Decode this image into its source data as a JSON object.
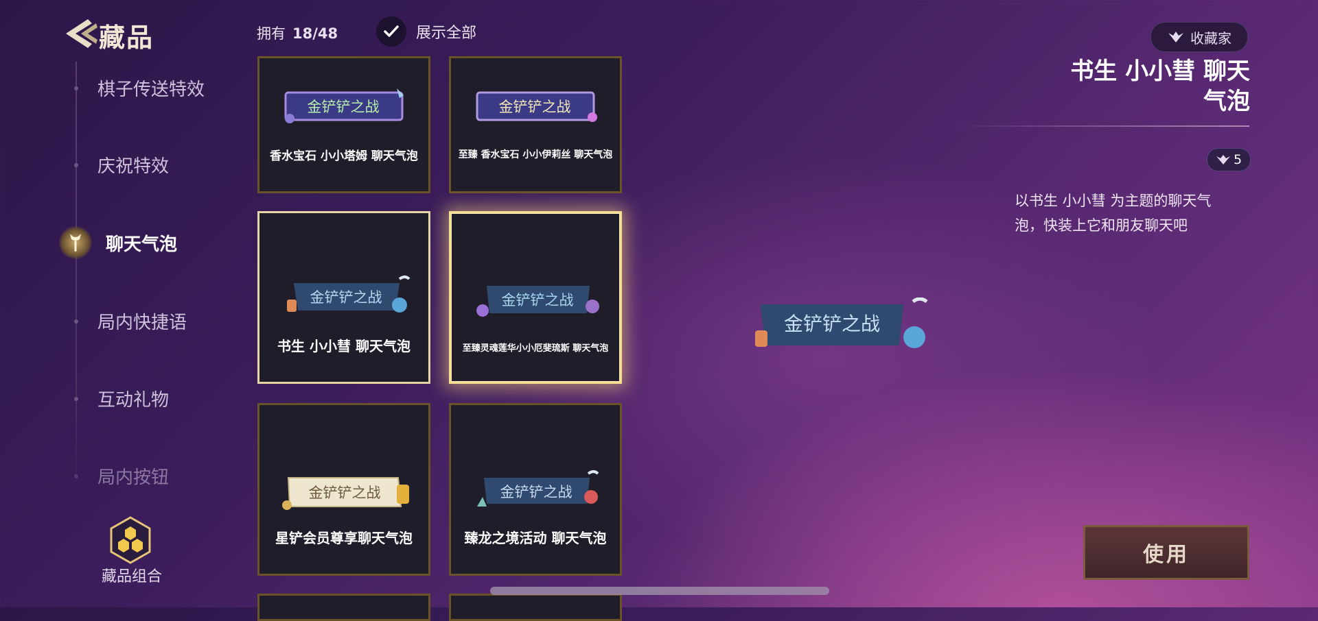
{
  "header": {
    "title": "藏品",
    "owned_label": "拥有",
    "owned_count": "18/48",
    "show_all_label": "展示全部"
  },
  "sidebar": {
    "items": [
      {
        "label": "棋子传送特效",
        "active": false
      },
      {
        "label": "庆祝特效",
        "active": false
      },
      {
        "label": "聊天气泡",
        "active": true
      },
      {
        "label": "局内快捷语",
        "active": false
      },
      {
        "label": "互动礼物",
        "active": false
      },
      {
        "label": "局内按钮",
        "active": false
      }
    ],
    "combo_label": "藏品组合"
  },
  "bubble_text": "金铲铲之战",
  "grid": {
    "cards": [
      {
        "name": "香水宝石  小小塔姆  聊天气泡",
        "style": "purple-rim",
        "state": "normal"
      },
      {
        "name": "至臻  香水宝石  小小伊莉丝  聊天气泡",
        "style": "purple-rim",
        "state": "normal"
      },
      {
        "name": "书生  小小彗  聊天气泡",
        "style": "blue-scroll",
        "state": "current"
      },
      {
        "name": "至臻灵魂莲华小小厄斐琉斯  聊天气泡",
        "style": "blue-lotus",
        "state": "selected"
      },
      {
        "name": "星铲会员尊享聊天气泡",
        "style": "parchment",
        "state": "normal"
      },
      {
        "name": "臻龙之境活动  聊天气泡",
        "style": "blue-dragon",
        "state": "normal"
      }
    ]
  },
  "detail": {
    "collector_label": "收藏家",
    "title_line1": "书生  小小彗  聊天",
    "title_line2": "气泡",
    "points": "5",
    "description_line1": "以书生  小小彗  为主题的聊天气",
    "description_line2": "泡，快装上它和朋友聊天吧",
    "use_button": "使用"
  },
  "colors": {
    "gold_frame": "#6b5328",
    "selected_frame": "#f6dc8e",
    "bubble_blue": "#2f4a6e",
    "bubble_purple": "#3a3a86",
    "parchment": "#efe6cf"
  }
}
